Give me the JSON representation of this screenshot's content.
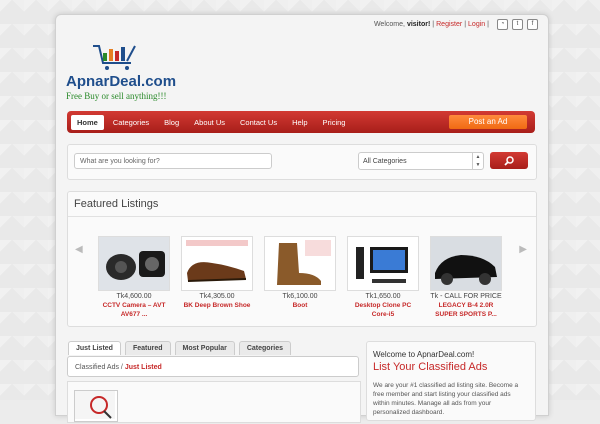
{
  "topbar": {
    "welcome": "Welcome,",
    "user": "visitor!",
    "register": "Register",
    "login": "Login"
  },
  "brand": {
    "name": "ApnarDeal.com",
    "tagline": "Free Buy or sell anything!!!"
  },
  "nav": {
    "items": [
      "Home",
      "Categories",
      "Blog",
      "About Us",
      "Contact Us",
      "Help",
      "Pricing"
    ],
    "post_ad": "Post an Ad"
  },
  "search": {
    "placeholder": "What are you looking for?",
    "category": "All Categories"
  },
  "featured": {
    "title": "Featured Listings",
    "listings": [
      {
        "price": "Tk4,600.00",
        "title": "CCTV Camera – AVT AV677 ..."
      },
      {
        "price": "Tk4,305.00",
        "title": "BK Deep Brown Shoe"
      },
      {
        "price": "Tk6,100.00",
        "title": "Boot"
      },
      {
        "price": "Tk1,650.00",
        "title": "Desktop Clone PC Core-i5"
      },
      {
        "price": "Tk - CALL FOR PRICE",
        "title": "LEGACY B-4 2.0R SUPER SPORTS P..."
      }
    ]
  },
  "tabs": [
    "Just Listed",
    "Featured",
    "Most Popular",
    "Categories"
  ],
  "breadcrumb": {
    "root": "Classified Ads",
    "sep": "/",
    "current": "Just Listed"
  },
  "welcome_box": {
    "title": "Welcome to ApnarDeal.com!",
    "subtitle": "List Your Classified Ads",
    "text": "We are your #1 classified ad listing site. Become a free member and start listing your classified ads within minutes. Manage all ads from your personalized dashboard."
  },
  "colors": {
    "accent": "#c62828",
    "orange": "#f06a12",
    "brand": "#1f4e8c"
  }
}
